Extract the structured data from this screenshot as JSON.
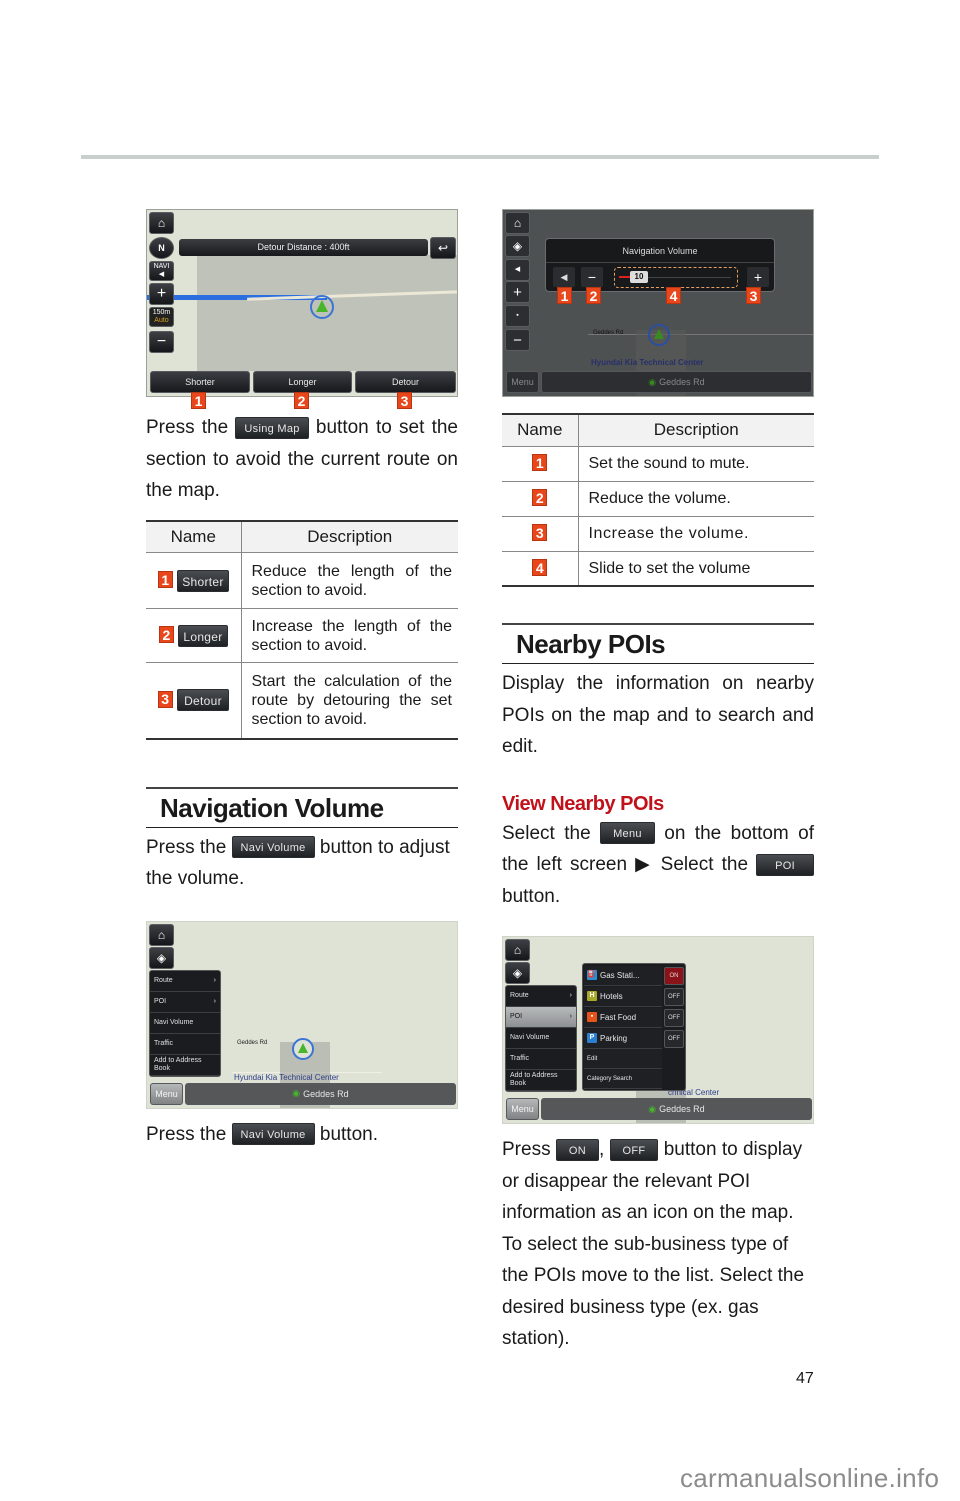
{
  "page": {
    "number": "47",
    "watermark": "carmanualsonline.info"
  },
  "detour_screen": {
    "banner": "Detour Distance : 400ft",
    "side_buttons": {
      "home": "⌂",
      "north": "N",
      "navi": "NAVI",
      "plus": "+",
      "scale": "150m",
      "auto": "Auto",
      "minus": "−"
    },
    "bottom_buttons": [
      "Shorter",
      "Longer",
      "Detour"
    ],
    "badges": [
      "1",
      "2",
      "3"
    ]
  },
  "detour_text": {
    "pre": "Press the",
    "button": "Using Map",
    "post": "button to set the section to avoid the current route on the map."
  },
  "detour_table": {
    "headers": [
      "Name",
      "Description"
    ],
    "rows": [
      {
        "badge": "1",
        "button": "Shorter",
        "desc": "Reduce the length of the section to avoid."
      },
      {
        "badge": "2",
        "button": "Longer",
        "desc": "Increase the length of the section to avoid."
      },
      {
        "badge": "3",
        "button": "Detour",
        "desc": "Start the calculation of the route by detouring the set section to avoid."
      }
    ]
  },
  "navi_volume_section": {
    "title": "Navigation Volume",
    "text_pre": "Press the",
    "button": "Navi Volume",
    "text_post": "button to adjust the volume.",
    "text2_pre": "Press the",
    "text2_post": "button."
  },
  "menu_screen": {
    "menu_items": [
      "Route",
      "POI",
      "Navi Volume",
      "Traffic",
      "Add to Address Book"
    ],
    "menu_button": "Menu",
    "road_label": "Geddes Rd",
    "place_label": "Hyundai Kia Technical Center",
    "current_road": "Geddes Rd"
  },
  "volume_screen": {
    "title": "Navigation Volume",
    "value": "10",
    "level_fraction": 0.1,
    "badges": [
      "1",
      "2",
      "4",
      "3"
    ],
    "menu_button": "Menu",
    "road_label": "Geddes Rd",
    "place_label": "Hyundai Kia Technical Center",
    "current_road": "Geddes Rd"
  },
  "volume_table": {
    "headers": [
      "Name",
      "Description"
    ],
    "rows": [
      {
        "badge": "1",
        "desc": "Set the sound to mute."
      },
      {
        "badge": "2",
        "desc": "Reduce the volume."
      },
      {
        "badge": "3",
        "desc": "Increase the volume."
      },
      {
        "badge": "4",
        "desc": "Slide to set the volume"
      }
    ]
  },
  "nearby_section": {
    "title": "Nearby POIs",
    "intro": "Display the information on nearby POIs on the map and to search and edit.",
    "subhead": "View Nearby POIs",
    "step_pre": "Select the",
    "menu_button": "Menu",
    "step_mid": "on the bottom of the left screen ▶ Select the",
    "poi_button": "POI",
    "step_post": "button.",
    "press": "Press",
    "on_button": "ON",
    "off_button": "OFF",
    "press_post": "button to display or disappear the relevant POI information as an icon on the map. To select the sub-business type of the POIs move to the list. Select the desired business type (ex. gas station)."
  },
  "poi_screen": {
    "menu_items": [
      "Route",
      "POI",
      "Navi Volume",
      "Traffic",
      "Add to Address Book"
    ],
    "poi_items": [
      {
        "name": "Gas Stati...",
        "state": "ON",
        "color": "#2a8fd6"
      },
      {
        "name": "Hotels",
        "state": "OFF",
        "color": "#a8a829"
      },
      {
        "name": "Fast Food",
        "state": "OFF",
        "color": "#e5541b"
      },
      {
        "name": "Parking",
        "state": "OFF",
        "color": "#2a7fd0"
      }
    ],
    "extra_items": [
      "Edit",
      "Category Search"
    ],
    "menu_button": "Menu",
    "place_label": "chnical Center",
    "current_road": "Geddes Rd"
  }
}
